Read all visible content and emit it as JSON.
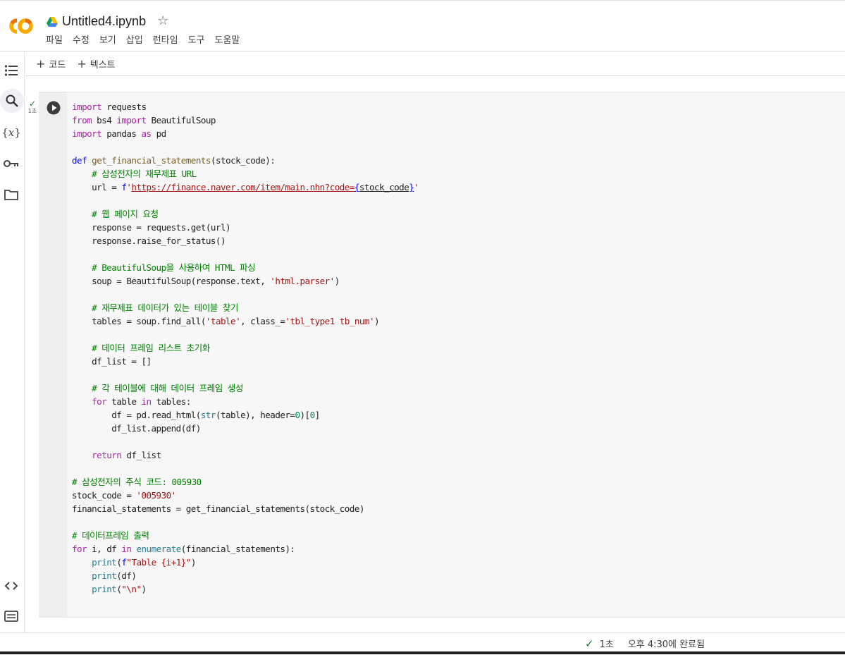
{
  "app": {
    "notebook_title": "Untitled4.ipynb",
    "logo_icon": "colab-logo-icon",
    "brand_color": "#f9ab00"
  },
  "menu": [
    "파일",
    "수정",
    "보기",
    "삽입",
    "런타임",
    "도구",
    "도움말"
  ],
  "toolbar": {
    "add_code_label": "코드",
    "add_text_label": "텍스트"
  },
  "sidebar": {
    "icons": [
      "table-of-contents-icon",
      "search-icon",
      "variables-icon",
      "secrets-key-icon",
      "files-folder-icon",
      "code-snippets-icon",
      "terminal-icon"
    ]
  },
  "cell": {
    "exec_time": "1초",
    "code_lines": [
      "import requests",
      "from bs4 import BeautifulSoup",
      "import pandas as pd",
      "",
      "def get_financial_statements(stock_code):",
      "    # 삼성전자의 재무제표 URL",
      "    url = f'https://finance.naver.com/item/main.nhn?code={stock_code}'",
      "",
      "    # 웹 페이지 요청",
      "    response = requests.get(url)",
      "    response.raise_for_status()",
      "",
      "    # BeautifulSoup을 사용하여 HTML 파싱",
      "    soup = BeautifulSoup(response.text, 'html.parser')",
      "",
      "    # 재무제표 데이터가 있는 테이블 찾기",
      "    tables = soup.find_all('table', class_='tbl_type1 tb_num')",
      "",
      "    # 데이터 프레임 리스트 초기화",
      "    df_list = []",
      "",
      "    # 각 테이블에 대해 데이터 프레임 생성",
      "    for table in tables:",
      "        df = pd.read_html(str(table), header=0)[0]",
      "        df_list.append(df)",
      "",
      "    return df_list",
      "",
      "# 삼성전자의 주식 코드: 005930",
      "stock_code = '005930'",
      "financial_statements = get_financial_statements(stock_code)",
      "",
      "# 데이터프레임 출력",
      "for i, df in enumerate(financial_statements):",
      "    print(f\"Table {i+1}\")",
      "    print(df)",
      "    print(\"\\n\")"
    ]
  },
  "status": {
    "duration": "1초",
    "completed": "오후 4:30에 완료됨"
  }
}
